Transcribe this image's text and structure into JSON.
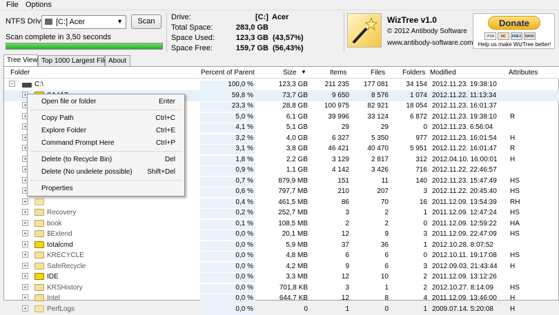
{
  "menu": [
    "File",
    "Options"
  ],
  "drive_select": {
    "label": "NTFS Drive:",
    "value": "[C:] Acer"
  },
  "scan_label": "Scan",
  "scan_status": "Scan complete in 3,50 seconds",
  "scan_progress_pct": 100,
  "drive_info": {
    "drive_label": "Drive:",
    "drive_letter": "[C:]",
    "drive_name": "Acer",
    "total_label": "Total Space:",
    "total_value": "283,0 GB",
    "used_label": "Space Used:",
    "used_value": "123,3 GB",
    "used_pct": "(43,57%)",
    "free_label": "Space Free:",
    "free_value": "159,7 GB",
    "free_pct": "(56,43%)"
  },
  "about": {
    "title": "WizTree v1.0",
    "copyright": "© 2012 Antibody Software",
    "url": "www.antibody-software.com"
  },
  "donate": {
    "label": "Donate",
    "help": "Help us make WizTree better!",
    "cards": [
      "VISA",
      "MC",
      "AMEX",
      "BANK"
    ]
  },
  "tabs": [
    "Tree View",
    "Top 1000 Largest Files",
    "About"
  ],
  "columns": {
    "folder": "Folder",
    "percent": "Percent of Parent",
    "size": "Size",
    "items": "Items",
    "files": "Files",
    "folders": "Folders",
    "modified": "Modified",
    "attributes": "Attributes"
  },
  "rows": [
    {
      "name": "C:\\",
      "pct": "100,0 %",
      "size": "123,3 GB",
      "items": "211 235",
      "files": "177 081",
      "folders": "34 154",
      "modified": "2012.11.23. 19:38:10",
      "attr": ""
    },
    {
      "name": "SAJÁT",
      "pct": "59,8 %",
      "size": "73,7 GB",
      "items": "9 650",
      "files": "8 576",
      "folders": "1 074",
      "modified": "2012.11.22. 11:13:34",
      "attr": ""
    },
    {
      "name": "",
      "pct": "23,3 %",
      "size": "28,8 GB",
      "items": "100 975",
      "files": "82 921",
      "folders": "18 054",
      "modified": "2012.11.23. 16:01:37",
      "attr": ""
    },
    {
      "name": "",
      "pct": "5,0 %",
      "size": "6,1 GB",
      "items": "39 996",
      "files": "33 124",
      "folders": "6 872",
      "modified": "2012.11.23. 19:38:10",
      "attr": "R"
    },
    {
      "name": "",
      "pct": "4,1 %",
      "size": "5,1 GB",
      "items": "29",
      "files": "29",
      "folders": "0",
      "modified": "2012.11.23. 6:56:04",
      "attr": ""
    },
    {
      "name": "",
      "pct": "3,2 %",
      "size": "4,0 GB",
      "items": "6 327",
      "files": "5 350",
      "folders": "977",
      "modified": "2012.11.23. 16:01:54",
      "attr": "H"
    },
    {
      "name": "",
      "pct": "3,1 %",
      "size": "3,8 GB",
      "items": "46 421",
      "files": "40 470",
      "folders": "5 951",
      "modified": "2012.11.22. 16:01:47",
      "attr": "R"
    },
    {
      "name": "",
      "pct": "1,8 %",
      "size": "2,2 GB",
      "items": "3 129",
      "files": "2 817",
      "folders": "312",
      "modified": "2012.04.10. 16:00:01",
      "attr": "H"
    },
    {
      "name": "",
      "pct": "0,9 %",
      "size": "1,1 GB",
      "items": "4 142",
      "files": "3 426",
      "folders": "716",
      "modified": "2012.11.22. 22:46:57",
      "attr": ""
    },
    {
      "name": "",
      "pct": "0,7 %",
      "size": "879,9 MB",
      "items": "151",
      "files": "11",
      "folders": "140",
      "modified": "2012.11.23. 15:47:49",
      "attr": "HS"
    },
    {
      "name": "",
      "pct": "0,6 %",
      "size": "797,7 MB",
      "items": "210",
      "files": "207",
      "folders": "3",
      "modified": "2012.11.22. 20:45:40",
      "attr": "HS"
    },
    {
      "name": "",
      "pct": "0,4 %",
      "size": "461,5 MB",
      "items": "86",
      "files": "70",
      "folders": "16",
      "modified": "2011.12.09. 13:54:39",
      "attr": "RH"
    },
    {
      "name": "Recovery",
      "pct": "0,2 %",
      "size": "252,7 MB",
      "items": "3",
      "files": "2",
      "folders": "1",
      "modified": "2011.12.09. 12:47:24",
      "attr": "HS"
    },
    {
      "name": "book",
      "pct": "0,1 %",
      "size": "108,5 MB",
      "items": "2",
      "files": "2",
      "folders": "0",
      "modified": "2011.12.09. 12:59:22",
      "attr": "HA"
    },
    {
      "name": "$Extend",
      "pct": "0,0 %",
      "size": "20,1 MB",
      "items": "12",
      "files": "9",
      "folders": "3",
      "modified": "2011.12.09. 22:47:09",
      "attr": "HS"
    },
    {
      "name": "totalcmd",
      "pct": "0,0 %",
      "size": "5,9 MB",
      "items": "37",
      "files": "36",
      "folders": "1",
      "modified": "2012.10.28. 8:07:52",
      "attr": ""
    },
    {
      "name": "KRECYCLE",
      "pct": "0,0 %",
      "size": "4,8 MB",
      "items": "6",
      "files": "6",
      "folders": "0",
      "modified": "2012.10.11. 19:17:08",
      "attr": "HS"
    },
    {
      "name": "SafeRecycle",
      "pct": "0,0 %",
      "size": "4,2 MB",
      "items": "9",
      "files": "6",
      "folders": "3",
      "modified": "2012.09.03. 21:43:44",
      "attr": "H"
    },
    {
      "name": "IDE",
      "pct": "0,0 %",
      "size": "3,3 MB",
      "items": "12",
      "files": "10",
      "folders": "2",
      "modified": "2011.12.09. 13:12:26",
      "attr": ""
    },
    {
      "name": "KRSHistory",
      "pct": "0,0 %",
      "size": "701,8 KB",
      "items": "3",
      "files": "1",
      "folders": "2",
      "modified": "2012.10.27. 8:14:09",
      "attr": "HS"
    },
    {
      "name": "Intel",
      "pct": "0,0 %",
      "size": "644,7 KB",
      "items": "12",
      "files": "8",
      "folders": "4",
      "modified": "2011.12.09. 13:46:00",
      "attr": "H"
    },
    {
      "name": "PerfLogs",
      "pct": "0,0 %",
      "size": "0",
      "items": "1",
      "files": "0",
      "folders": "1",
      "modified": "2009.07.14. 5:20:08",
      "attr": "H"
    }
  ],
  "context_menu": [
    {
      "label": "Open file or folder",
      "shortcut": "Enter"
    },
    {
      "label": "Copy Path",
      "shortcut": "Ctrl+C"
    },
    {
      "label": "Explore Folder",
      "shortcut": "Ctrl+E"
    },
    {
      "label": "Command Prompt Here",
      "shortcut": "Ctrl+P"
    },
    {
      "label": "Delete (to Recycle Bin)",
      "shortcut": "Del"
    },
    {
      "label": "Delete (No undelete possible)",
      "shortcut": "Shift+Del"
    },
    {
      "label": "Properties",
      "shortcut": ""
    }
  ]
}
